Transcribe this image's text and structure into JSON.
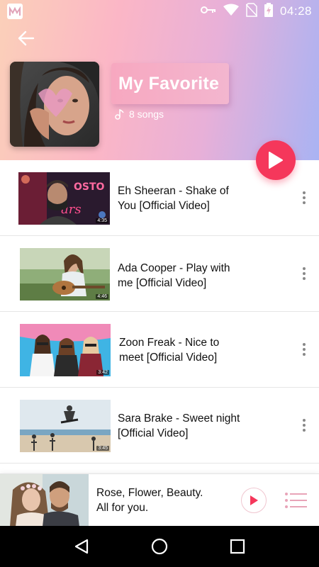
{
  "status_bar": {
    "time": "04:28",
    "icons": [
      "app-badge-icon",
      "key-icon",
      "wifi-icon",
      "no-sim-icon",
      "battery-charging-icon"
    ]
  },
  "header": {
    "back_icon": "arrow-left-icon",
    "playlist_title": "My Favorite",
    "songs_count": "8 songs",
    "songs_icon": "music-note-icon",
    "play_icon": "play-icon",
    "gradient": [
      "#fbd0b9",
      "#fbb6c6",
      "#e8b0d8",
      "#a9b3f3"
    ]
  },
  "songs": [
    {
      "title": "Eh Sheeran - Shake of You [Official Video]",
      "duration": "4:35"
    },
    {
      "title": "Ada Cooper - Play with me [Official Video]",
      "duration": "4:46"
    },
    {
      "title": "Zoon Freak - Nice to meet [Official Video]",
      "duration": "3:42"
    },
    {
      "title": "Sara Brake - Sweet night [Official Video]",
      "duration": "3:45"
    }
  ],
  "mini_player": {
    "title_line1": "Rose, Flower, Beauty.",
    "title_line2": "All for you.",
    "play_icon": "play-icon",
    "queue_icon": "queue-list-icon"
  },
  "nav_bar": {
    "back_icon": "triangle-back-icon",
    "home_icon": "circle-home-icon",
    "recents_icon": "square-recents-icon"
  },
  "colors": {
    "accent": "#f5375b",
    "text": "#111111",
    "divider": "#e6e6e6"
  }
}
